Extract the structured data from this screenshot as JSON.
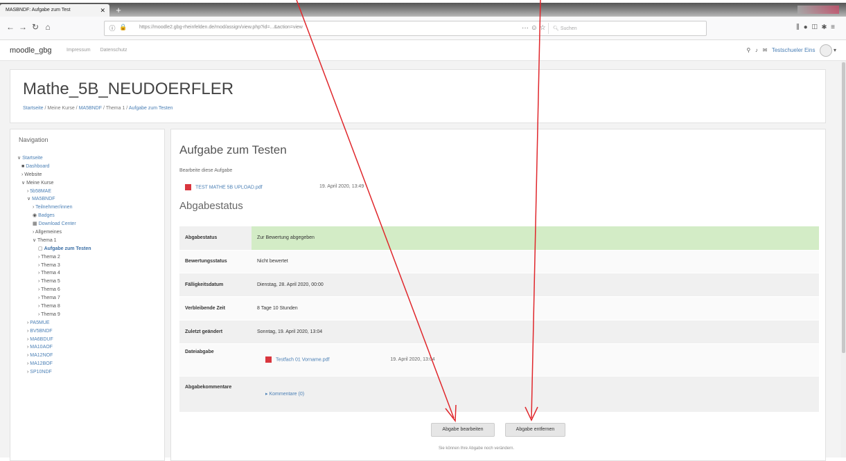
{
  "browser": {
    "tab_title": "MASBNDF: Aufgabe zum Test",
    "url": "https://moodle2.gbg-rheinfelden.de/mod/assign/view.php?id=...&action=view",
    "search_placeholder": "Suchen",
    "page_actions": "··· ☺ ☆"
  },
  "moodle": {
    "brand": "moodle_gbg",
    "topnav": [
      "Impressum",
      "Datenschutz"
    ],
    "user_name": "Testschueler Eins"
  },
  "course": {
    "title": "Mathe_5B_NEUDOERFLER",
    "breadcrumb": [
      "Startseite",
      "Meine Kurse",
      "MA5BNDF",
      "Thema 1",
      "Aufgabe zum Testen"
    ]
  },
  "navigation": {
    "title": "Navigation",
    "items": [
      {
        "label": "Startseite",
        "style": "link"
      },
      {
        "label": "Dashboard",
        "style": "link"
      },
      {
        "label": "Website",
        "style": "plain"
      },
      {
        "label": "Meine Kurse",
        "style": "plain"
      },
      {
        "label": "5b58MAE",
        "style": "link"
      },
      {
        "label": "MA5BNDF",
        "style": "link"
      },
      {
        "label": "Teilnehmer/innen",
        "style": "link"
      },
      {
        "label": "Badges",
        "style": "link"
      },
      {
        "label": "Download Center",
        "style": "link"
      },
      {
        "label": "Allgemeines",
        "style": "plain"
      },
      {
        "label": "Thema 1",
        "style": "plain"
      },
      {
        "label": "Aufgabe zum Testen",
        "style": "bold"
      },
      {
        "label": "Thema 2",
        "style": "plain"
      },
      {
        "label": "Thema 3",
        "style": "plain"
      },
      {
        "label": "Thema 4",
        "style": "plain"
      },
      {
        "label": "Thema 5",
        "style": "plain"
      },
      {
        "label": "Thema 6",
        "style": "plain"
      },
      {
        "label": "Thema 7",
        "style": "plain"
      },
      {
        "label": "Thema 8",
        "style": "plain"
      },
      {
        "label": "Thema 9",
        "style": "plain"
      },
      {
        "label": "PA5MUE",
        "style": "link"
      },
      {
        "label": "BV5BNDF",
        "style": "link"
      },
      {
        "label": "MA6BDUF",
        "style": "link"
      },
      {
        "label": "MA10AOF",
        "style": "link"
      },
      {
        "label": "MA12NOF",
        "style": "link"
      },
      {
        "label": "MA12BOF",
        "style": "link"
      },
      {
        "label": "SP10NDF",
        "style": "link"
      }
    ]
  },
  "assignment": {
    "title": "Aufgabe zum Testen",
    "instructions": "Bearbeite diese Aufgabe",
    "file_name": "TEST MATHE 5B UPLOAD.pdf",
    "file_date": "19. April 2020, 13:49",
    "status_heading": "Abgabestatus",
    "rows": [
      {
        "label": "Abgabestatus",
        "value": "Zur Bewertung abgegeben"
      },
      {
        "label": "Bewertungsstatus",
        "value": "Nicht bewertet"
      },
      {
        "label": "Fälligkeitsdatum",
        "value": "Dienstag, 28. April 2020, 00:00"
      },
      {
        "label": "Verbleibende Zeit",
        "value": "8 Tage 10 Stunden"
      },
      {
        "label": "Zuletzt geändert",
        "value": "Sonntag, 19. April 2020, 13:04"
      },
      {
        "label": "Dateiabgabe",
        "value": "Testfach 01 Vorname.pdf",
        "date": "19. April 2020, 13:04"
      },
      {
        "label": "Abgabekommentare",
        "value": "Kommentare (0)"
      }
    ],
    "edit_button": "Abgabe bearbeiten",
    "remove_button": "Abgabe entfernen",
    "note": "Sie können Ihre Abgabe noch verändern."
  },
  "colors": {
    "accent_link": "#4a7fb5",
    "status_green": "#d3ecc6",
    "arrow_red": "#e0262b",
    "pdf_red": "#d9363e"
  }
}
